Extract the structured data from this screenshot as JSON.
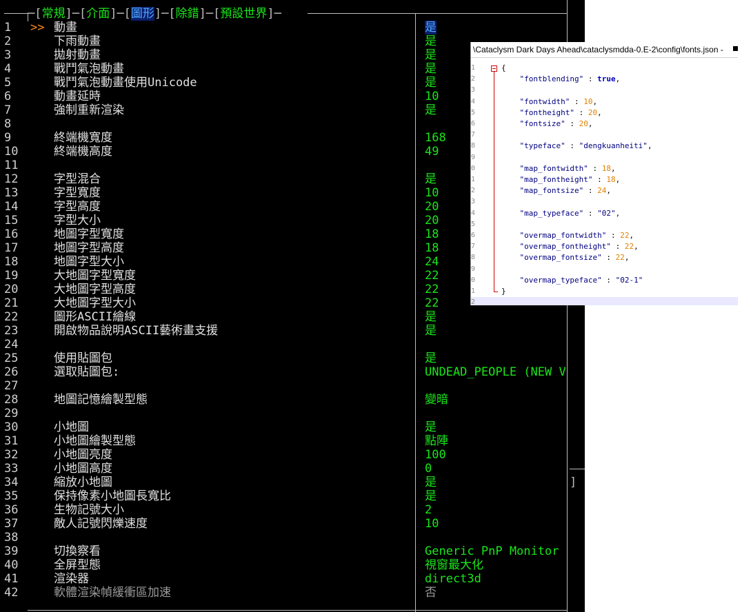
{
  "tabs": {
    "general": "常規",
    "interface": "介面",
    "graphics": "圖形",
    "debug": "除錯",
    "world_defaults": "預設世界"
  },
  "cursor": ">>",
  "rows": [
    {
      "n": "1",
      "label": "動畫",
      "value": "是"
    },
    {
      "n": "2",
      "label": "下雨動畫",
      "value": "是"
    },
    {
      "n": "3",
      "label": "拋射動畫",
      "value": "是"
    },
    {
      "n": "4",
      "label": "戰鬥氣泡動畫",
      "value": "是"
    },
    {
      "n": "5",
      "label": "戰鬥氣泡動畫使用Unicode",
      "value": "是"
    },
    {
      "n": "6",
      "label": "動畫延時",
      "value": "10"
    },
    {
      "n": "7",
      "label": "強制重新渲染",
      "value": "是"
    },
    {
      "n": "8",
      "label": "",
      "value": ""
    },
    {
      "n": "9",
      "label": "終端機寬度",
      "value": "168"
    },
    {
      "n": "10",
      "label": "終端機高度",
      "value": "49"
    },
    {
      "n": "11",
      "label": "",
      "value": ""
    },
    {
      "n": "12",
      "label": "字型混合",
      "value": "是"
    },
    {
      "n": "13",
      "label": "字型寬度",
      "value": "10"
    },
    {
      "n": "14",
      "label": "字型高度",
      "value": "20"
    },
    {
      "n": "15",
      "label": "字型大小",
      "value": "20"
    },
    {
      "n": "16",
      "label": "地圖字型寬度",
      "value": "18"
    },
    {
      "n": "17",
      "label": "地圖字型高度",
      "value": "18"
    },
    {
      "n": "18",
      "label": "地圖字型大小",
      "value": "24"
    },
    {
      "n": "19",
      "label": "大地圖字型寬度",
      "value": "22"
    },
    {
      "n": "20",
      "label": "大地圖字型高度",
      "value": "22"
    },
    {
      "n": "21",
      "label": "大地圖字型大小",
      "value": "22"
    },
    {
      "n": "22",
      "label": "圖形ASCII繪線",
      "value": "是"
    },
    {
      "n": "23",
      "label": "開啟物品說明ASCII藝術畫支援",
      "value": "是"
    },
    {
      "n": "24",
      "label": "",
      "value": ""
    },
    {
      "n": "25",
      "label": "使用貼圖包",
      "value": "是"
    },
    {
      "n": "26",
      "label": "選取貼圖包:",
      "value": "UNDEAD_PEOPLE (NEW V"
    },
    {
      "n": "27",
      "label": "",
      "value": ""
    },
    {
      "n": "28",
      "label": "地圖記憶繪製型態",
      "value": "變暗"
    },
    {
      "n": "29",
      "label": "",
      "value": ""
    },
    {
      "n": "30",
      "label": "小地圖",
      "value": "是"
    },
    {
      "n": "31",
      "label": "小地圖繪製型態",
      "value": "點陣"
    },
    {
      "n": "32",
      "label": "小地圖亮度",
      "value": "100"
    },
    {
      "n": "33",
      "label": "小地圖高度",
      "value": "0"
    },
    {
      "n": "34",
      "label": "縮放小地圖",
      "value": "是"
    },
    {
      "n": "35",
      "label": "保持像素小地圖長寬比",
      "value": "是"
    },
    {
      "n": "36",
      "label": "生物記號大小",
      "value": "2"
    },
    {
      "n": "37",
      "label": "敵人記號閃爍速度",
      "value": "10"
    },
    {
      "n": "38",
      "label": "",
      "value": ""
    },
    {
      "n": "39",
      "label": "切換察看",
      "value": "Generic PnP Monitor"
    },
    {
      "n": "40",
      "label": "全屏型態",
      "value": "視窗最大化"
    },
    {
      "n": "41",
      "label": "渲染器",
      "value": "direct3d"
    },
    {
      "n": "42",
      "label": "軟體渲染幀緩衝區加速",
      "value": "否"
    }
  ],
  "trailing_bracket": "]",
  "editor": {
    "title": "\\Cataclysm Dark Days Ahead\\cataclysmdda-0.E-2\\config\\fonts.json -",
    "lines": [
      {
        "ln": "1",
        "segs": [
          {
            "c": "p",
            "t": "{"
          }
        ]
      },
      {
        "ln": "2",
        "segs": [
          {
            "c": "k",
            "t": "    \"fontblending\""
          },
          {
            "c": "p",
            "t": " : "
          },
          {
            "c": "b",
            "t": "true"
          },
          {
            "c": "p",
            "t": ","
          }
        ]
      },
      {
        "ln": "3",
        "segs": []
      },
      {
        "ln": "4",
        "segs": [
          {
            "c": "k",
            "t": "    \"fontwidth\""
          },
          {
            "c": "p",
            "t": " : "
          },
          {
            "c": "n",
            "t": "10"
          },
          {
            "c": "p",
            "t": ","
          }
        ]
      },
      {
        "ln": "5",
        "segs": [
          {
            "c": "k",
            "t": "    \"fontheight\""
          },
          {
            "c": "p",
            "t": " : "
          },
          {
            "c": "n",
            "t": "20"
          },
          {
            "c": "p",
            "t": ","
          }
        ]
      },
      {
        "ln": "6",
        "segs": [
          {
            "c": "k",
            "t": "    \"fontsize\""
          },
          {
            "c": "p",
            "t": " : "
          },
          {
            "c": "n",
            "t": "20"
          },
          {
            "c": "p",
            "t": ","
          }
        ]
      },
      {
        "ln": "7",
        "segs": []
      },
      {
        "ln": "8",
        "segs": [
          {
            "c": "k",
            "t": "    \"typeface\""
          },
          {
            "c": "p",
            "t": " : "
          },
          {
            "c": "k",
            "t": "\"dengkuanheiti\""
          },
          {
            "c": "p",
            "t": ","
          }
        ]
      },
      {
        "ln": "9",
        "segs": []
      },
      {
        "ln": "0",
        "segs": [
          {
            "c": "k",
            "t": "    \"map_fontwidth\""
          },
          {
            "c": "p",
            "t": " : "
          },
          {
            "c": "n",
            "t": "18"
          },
          {
            "c": "p",
            "t": ","
          }
        ]
      },
      {
        "ln": "1",
        "segs": [
          {
            "c": "k",
            "t": "    \"map_fontheight\""
          },
          {
            "c": "p",
            "t": " : "
          },
          {
            "c": "n",
            "t": "18"
          },
          {
            "c": "p",
            "t": ","
          }
        ]
      },
      {
        "ln": "2",
        "segs": [
          {
            "c": "k",
            "t": "    \"map_fontsize\""
          },
          {
            "c": "p",
            "t": " : "
          },
          {
            "c": "n",
            "t": "24"
          },
          {
            "c": "p",
            "t": ","
          }
        ]
      },
      {
        "ln": "3",
        "segs": []
      },
      {
        "ln": "4",
        "segs": [
          {
            "c": "k",
            "t": "    \"map_typeface\""
          },
          {
            "c": "p",
            "t": " : "
          },
          {
            "c": "k",
            "t": "\"02\""
          },
          {
            "c": "p",
            "t": ","
          }
        ]
      },
      {
        "ln": "5",
        "segs": []
      },
      {
        "ln": "6",
        "segs": [
          {
            "c": "k",
            "t": "    \"overmap_fontwidth\""
          },
          {
            "c": "p",
            "t": " : "
          },
          {
            "c": "n",
            "t": "22"
          },
          {
            "c": "p",
            "t": ","
          }
        ]
      },
      {
        "ln": "7",
        "segs": [
          {
            "c": "k",
            "t": "    \"overmap_fontheight\""
          },
          {
            "c": "p",
            "t": " : "
          },
          {
            "c": "n",
            "t": "22"
          },
          {
            "c": "p",
            "t": ","
          }
        ]
      },
      {
        "ln": "8",
        "segs": [
          {
            "c": "k",
            "t": "    \"overmap_fontsize\""
          },
          {
            "c": "p",
            "t": " : "
          },
          {
            "c": "n",
            "t": "22"
          },
          {
            "c": "p",
            "t": ","
          }
        ]
      },
      {
        "ln": "9",
        "segs": []
      },
      {
        "ln": "0",
        "segs": [
          {
            "c": "k",
            "t": "    \"overmap_typeface\""
          },
          {
            "c": "p",
            "t": " : "
          },
          {
            "c": "k",
            "t": "\"02-1\""
          }
        ]
      },
      {
        "ln": "1",
        "segs": [
          {
            "c": "p",
            "t": "}"
          }
        ]
      },
      {
        "ln": "2",
        "segs": []
      }
    ]
  }
}
